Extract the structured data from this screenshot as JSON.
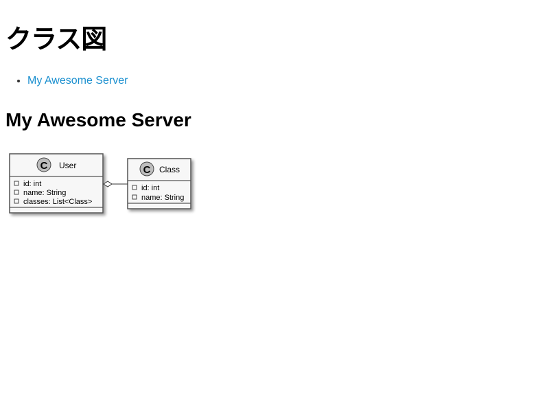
{
  "page": {
    "title": "クラス図"
  },
  "toc": {
    "items": [
      {
        "label": "My Awesome Server"
      }
    ]
  },
  "section": {
    "title": "My Awesome Server"
  },
  "diagram": {
    "classes": [
      {
        "id": "user",
        "stereotype_letter": "C",
        "name": "User",
        "attributes": [
          "id: int",
          "name: String",
          "classes: List<Class>"
        ]
      },
      {
        "id": "class",
        "stereotype_letter": "C",
        "name": "Class",
        "attributes": [
          "id: int",
          "name: String"
        ]
      }
    ],
    "relations": [
      {
        "from": "User",
        "to": "Class",
        "type": "aggregation"
      }
    ]
  }
}
